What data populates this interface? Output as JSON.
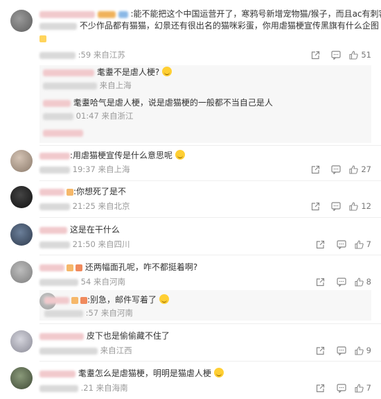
{
  "comments": [
    {
      "text1": "能不能把这个中国运营开了，寒鸦号新增宠物猫/猴子，而且ac有刺客喵",
      "text2": "不少作品都有猫猫，幻景还有很出名的猫咪彩蛋，你用虐猫梗宣传黑旗有什么企图",
      "time": ":59",
      "loc": "来自江苏",
      "likes": "51"
    },
    {
      "text": "用虐猫梗宣传是什么意思呢",
      "time": "19:37",
      "loc": "来自上海",
      "likes": "27"
    },
    {
      "text": "你想死了是不",
      "time": "21:25",
      "loc": "来自北京",
      "likes": "12"
    },
    {
      "text": "这是在干什么",
      "time": "21:50",
      "loc": "来自四川",
      "likes": "7"
    },
    {
      "text": "还两幅面孔呢，咋不都挺着啊?",
      "time": "54",
      "loc": "来自河南",
      "likes": "8"
    },
    {
      "text": "皮下也是偷偷藏不住了",
      "time": "",
      "loc": "来自江西",
      "likes": "9"
    },
    {
      "text": "耄耋怎么是虐猫梗，明明是猫虐人梗",
      "time": ".21",
      "loc": "来自海南",
      "likes": "7"
    }
  ],
  "replies": [
    {
      "text": "耄耋不是虐人梗?",
      "time": "",
      "loc": "来自上海"
    },
    {
      "text": "耄耋哈气是虐人梗，说是虐猫梗的一般都不当自己是人",
      "time": "01:47",
      "loc": "来自浙江"
    },
    {
      "text": "别急，邮件写着了",
      "time": ":57",
      "loc": "来自河南"
    }
  ]
}
